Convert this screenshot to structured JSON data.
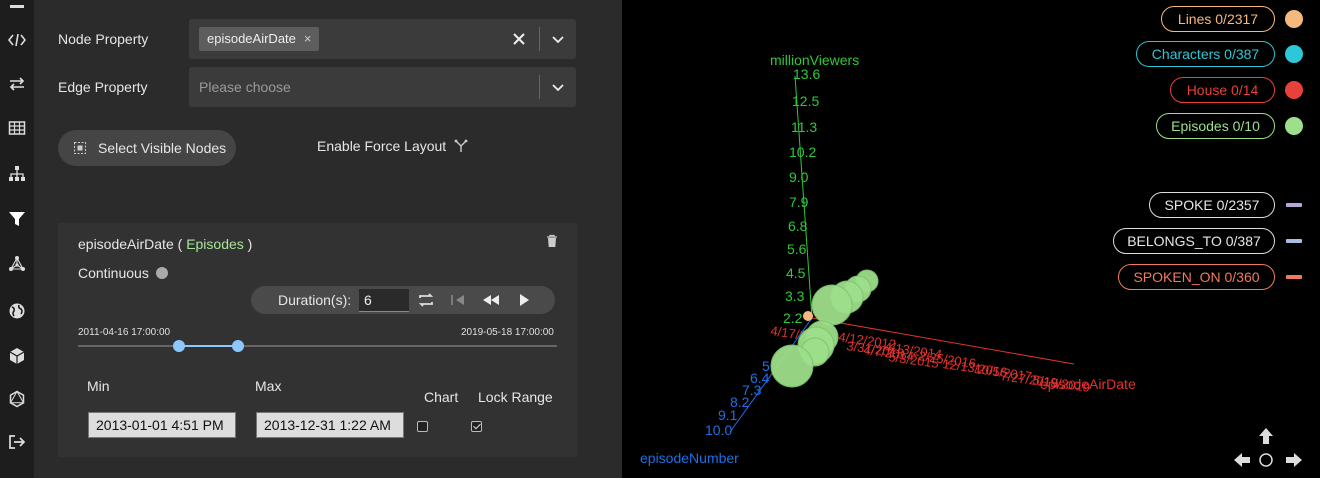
{
  "sidebar": {
    "icons": [
      "code-icon",
      "swap-arrows-icon",
      "table-icon",
      "hierarchy-icon",
      "filter-icon",
      "network-icon",
      "globe-icon",
      "cube-icon",
      "graphql-icon",
      "exit-icon"
    ],
    "active": "filter-icon"
  },
  "panel": {
    "node_property_label": "Node Property",
    "node_property_tag": "episodeAirDate",
    "tag_remove": "×",
    "edge_property_label": "Edge Property",
    "edge_property_placeholder": "Please choose",
    "select_visible_nodes": "Select Visible Nodes",
    "enable_force_layout": "Enable Force Layout"
  },
  "filter": {
    "property": "episodeAirDate",
    "open_paren": " ( ",
    "category": "Episodes",
    "close_paren": " )",
    "mode": "Continuous",
    "duration_label": "Duration(s):",
    "duration_value": "6",
    "range_start": "2011-04-16 17:00:00",
    "range_end": "2019-05-18 17:00:00",
    "min_label": "Min",
    "max_label": "Max",
    "min_value": "2013-01-01 4:51 PM",
    "max_value": "2013-12-31 1:22 AM",
    "chart_label": "Chart",
    "lock_range_label": "Lock Range",
    "chart_checked": false,
    "lock_range_checked": true,
    "selected_range_fraction": [
      0.211,
      0.334
    ]
  },
  "legend": {
    "nodes": [
      {
        "label": "Lines 0/2317",
        "color": "#f5b87f"
      },
      {
        "label": "Characters 0/387",
        "color": "#2cc7d8"
      },
      {
        "label": "House 0/14",
        "color": "#e8403a"
      },
      {
        "label": "Episodes 0/10",
        "color": "#9ddf8a"
      }
    ],
    "edges": [
      {
        "label": "SPOKE 0/2357",
        "color": "#b8a6d9"
      },
      {
        "label": "BELONGS_TO 0/387",
        "color": "#a7bde8"
      },
      {
        "label": "SPOKEN_ON 0/360",
        "color": "#f07a5c"
      }
    ]
  },
  "axes": {
    "y_title": "millionViewers",
    "y_ticks": [
      "13.6",
      "12.5",
      "11.3",
      "10.2",
      "9.0",
      "7.9",
      "6.8",
      "5.6",
      "4.5",
      "3.3",
      "2.2"
    ],
    "x_title": "episodeAirDate",
    "x_ticks": [
      "4/17/2011",
      "4/12/2012",
      "3/31/2013",
      "4/7/2014",
      "4/13/2014",
      "5/3/2015",
      "2/25/2016",
      "12/13/2016",
      "10/5/2017",
      "7/27/2018",
      "5/19/2019"
    ],
    "z_title": "episodeNumber",
    "z_ticks": [
      "10.0",
      "9.1",
      "8.2",
      "7.3",
      "6.4",
      "5"
    ],
    "colors": {
      "y": "#2ec93a",
      "x": "#e0322d",
      "z": "#1e6fe8"
    }
  }
}
